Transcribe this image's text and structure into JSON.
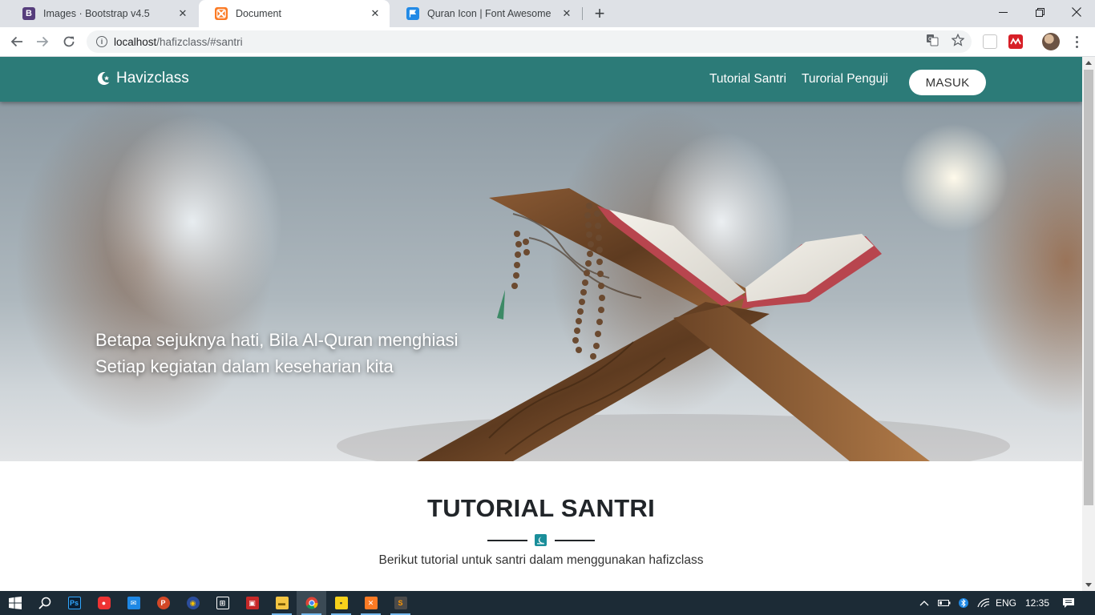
{
  "browser": {
    "tabs": [
      {
        "title": "Images · Bootstrap v4.5",
        "favicon": "B",
        "favicon_color": "#563d7c",
        "active": false
      },
      {
        "title": "Document",
        "favicon": "xampp",
        "favicon_color": "#fb7a24",
        "active": true
      },
      {
        "title": "Quran Icon | Font Awesome",
        "favicon": "flag",
        "favicon_color": "#228ae6",
        "active": false
      }
    ],
    "url_host": "localhost",
    "url_path": "/hafizclass/#santri"
  },
  "site": {
    "brand": "Havizclass",
    "nav": {
      "tutorial_santri": "Tutorial Santri",
      "tutorial_penguji": "Turorial Penguji",
      "login": "MASUK"
    },
    "hero": {
      "line1": "Betapa sejuknya hati, Bila Al-Quran menghiasi",
      "line2": "Setiap kegiatan dalam keseharian kita"
    },
    "section": {
      "title": "TUTORIAL SANTRI",
      "subtitle": "Berikut tutorial untuk santri dalam menggunakan hafizclass"
    },
    "colors": {
      "primary": "#2c7b78",
      "divider_icon": "#1a8e9a"
    }
  },
  "taskbar": {
    "language": "ENG",
    "time": "12:35"
  }
}
